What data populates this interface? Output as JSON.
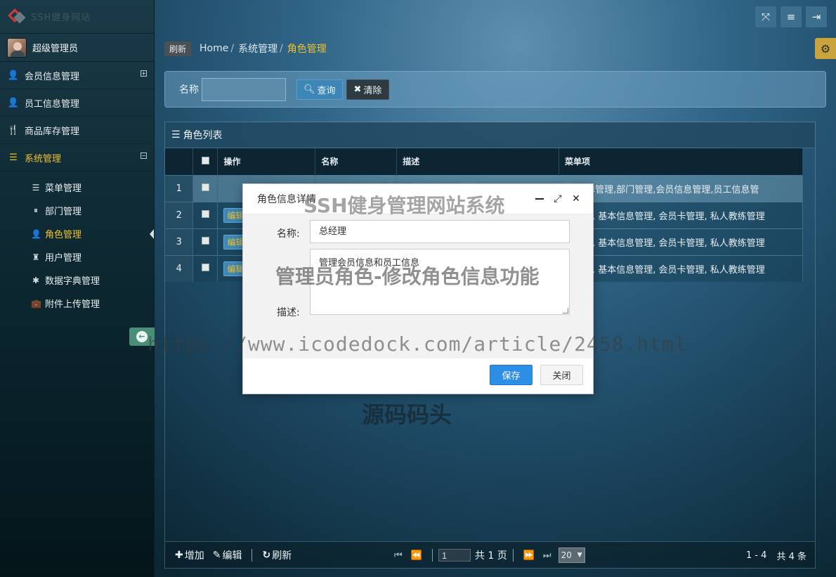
{
  "logo": {
    "text": "SSH健身网站"
  },
  "user": {
    "name": "超级管理员"
  },
  "sidebar": {
    "items": [
      {
        "icon": "👤",
        "label": "会员信息管理",
        "toggle": "+"
      },
      {
        "icon": "👤",
        "label": "员工信息管理",
        "toggle": ""
      },
      {
        "icon": "🍴",
        "label": "商品库存管理",
        "toggle": ""
      },
      {
        "icon": "☰",
        "label": "系统管理",
        "toggle": "−"
      }
    ],
    "subitems": [
      {
        "icon": "☰",
        "label": "菜单管理"
      },
      {
        "icon": "⏸",
        "label": "部门管理"
      },
      {
        "icon": "👤",
        "label": "角色管理"
      },
      {
        "icon": "♜",
        "label": "用户管理"
      },
      {
        "icon": "✱",
        "label": "数据字典管理"
      },
      {
        "icon": "💼",
        "label": "附件上传管理"
      }
    ],
    "collapse_icon": "←"
  },
  "topbar": {
    "fullscreen_icon": "⤧",
    "menu_icon": "≡",
    "logout_icon": "⇥",
    "settings_icon": "⚙"
  },
  "breadcrumb": {
    "refresh": "刷新",
    "home": "Home",
    "level1": "系统管理",
    "current": "角色管理"
  },
  "search": {
    "label": "名称",
    "value": "",
    "query_label": "查询",
    "clear_label": "清除"
  },
  "grid": {
    "title": "角色列表",
    "columns": [
      "操作",
      "名称",
      "描述",
      "菜单项"
    ],
    "rows": [
      {
        "num": "1",
        "edit": "",
        "name": "",
        "desc": "",
        "menu": "理,菜单管理,部门管理,会员信息管理,员工信息管"
      },
      {
        "num": "2",
        "edit": "编辑",
        "name": "",
        "desc": "",
        "menu": "息管理, 基本信息管理, 会员卡管理, 私人教练管理"
      },
      {
        "num": "3",
        "edit": "编辑",
        "name": "",
        "desc": "",
        "menu": "息管理, 基本信息管理, 会员卡管理, 私人教练管理"
      },
      {
        "num": "4",
        "edit": "编辑",
        "name": "",
        "desc": "",
        "menu": "息管理, 基本信息管理, 会员卡管理, 私人教练管理"
      }
    ],
    "footer": {
      "add_label": "增加",
      "edit_label": "编辑",
      "refresh_label": "刷新",
      "page_value": "1",
      "page_total": "共 1 页",
      "page_size": "20",
      "range": "1 - 4",
      "total": "共 4 条"
    }
  },
  "modal": {
    "title": "角色信息详情",
    "name_label": "名称:",
    "name_value": "总经理",
    "desc_label": "描述:",
    "desc_value": "管理会员信息和员工信息",
    "save_label": "保存",
    "close_label": "关闭"
  },
  "watermarks": {
    "title": "SSH健身管理网站系统",
    "subtitle": "管理员角色-修改角色信息功能",
    "url": "https://www.icodedock.com/article/2458.html",
    "brand": "源码码头"
  }
}
